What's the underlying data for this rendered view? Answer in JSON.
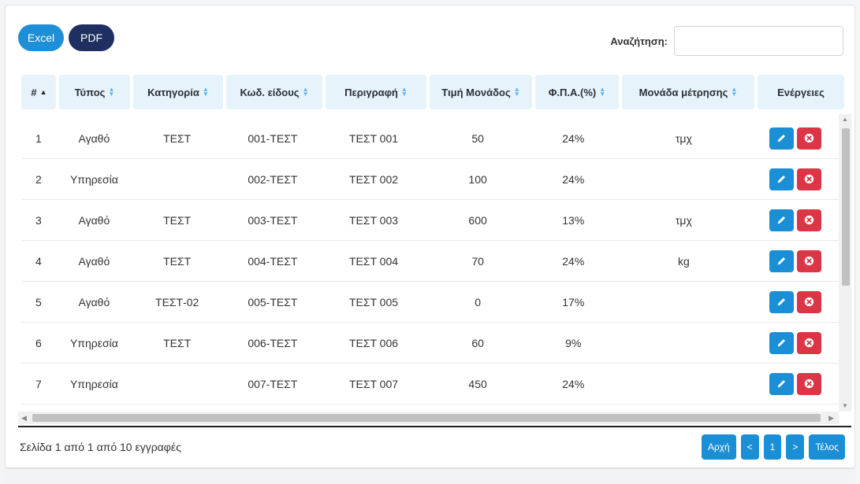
{
  "toolbar": {
    "excel_label": "Excel",
    "pdf_label": "PDF"
  },
  "search": {
    "label": "Αναζήτηση:",
    "value": "",
    "placeholder": ""
  },
  "columns": [
    "#",
    "Τύπος",
    "Κατηγορία",
    "Κωδ. είδους",
    "Περιγραφή",
    "Τιμή Μονάδος",
    "Φ.Π.Α.(%)",
    "Μονάδα μέτρησης",
    "Ενέργειες"
  ],
  "rows": [
    {
      "num": "1",
      "type": "Αγαθό",
      "category": "ΤΕΣΤ",
      "code": "001-ΤΕΣΤ",
      "desc": "ΤΕΣΤ 001",
      "price": "50",
      "vat": "24%",
      "unit": "τμχ"
    },
    {
      "num": "2",
      "type": "Υπηρεσία",
      "category": "",
      "code": "002-ΤΕΣΤ",
      "desc": "ΤΕΣΤ 002",
      "price": "100",
      "vat": "24%",
      "unit": ""
    },
    {
      "num": "3",
      "type": "Αγαθό",
      "category": "ΤΕΣΤ",
      "code": "003-ΤΕΣΤ",
      "desc": "ΤΕΣΤ 003",
      "price": "600",
      "vat": "13%",
      "unit": "τμχ"
    },
    {
      "num": "4",
      "type": "Αγαθό",
      "category": "ΤΕΣΤ",
      "code": "004-ΤΕΣΤ",
      "desc": "ΤΕΣΤ 004",
      "price": "70",
      "vat": "24%",
      "unit": "kg"
    },
    {
      "num": "5",
      "type": "Αγαθό",
      "category": "ΤΕΣΤ-02",
      "code": "005-ΤΕΣΤ",
      "desc": "ΤΕΣΤ 005",
      "price": "0",
      "vat": "17%",
      "unit": ""
    },
    {
      "num": "6",
      "type": "Υπηρεσία",
      "category": "ΤΕΣΤ",
      "code": "006-ΤΕΣΤ",
      "desc": "ΤΕΣΤ 006",
      "price": "60",
      "vat": "9%",
      "unit": ""
    },
    {
      "num": "7",
      "type": "Υπηρεσία",
      "category": "",
      "code": "007-ΤΕΣΤ",
      "desc": "ΤΕΣΤ 007",
      "price": "450",
      "vat": "24%",
      "unit": ""
    }
  ],
  "actions": {
    "edit_icon": "pencil-icon",
    "delete_icon": "close-circle-icon"
  },
  "info": "Σελίδα 1 από 1 από 10 εγγραφές",
  "pager": {
    "first": "Αρχή",
    "prev": "<",
    "page": "1",
    "next": ">",
    "last": "Τέλος"
  },
  "colors": {
    "accent": "#1b8fd6",
    "dark": "#1f2f61",
    "danger": "#dc3545",
    "header_bg": "#e6f3fb"
  }
}
